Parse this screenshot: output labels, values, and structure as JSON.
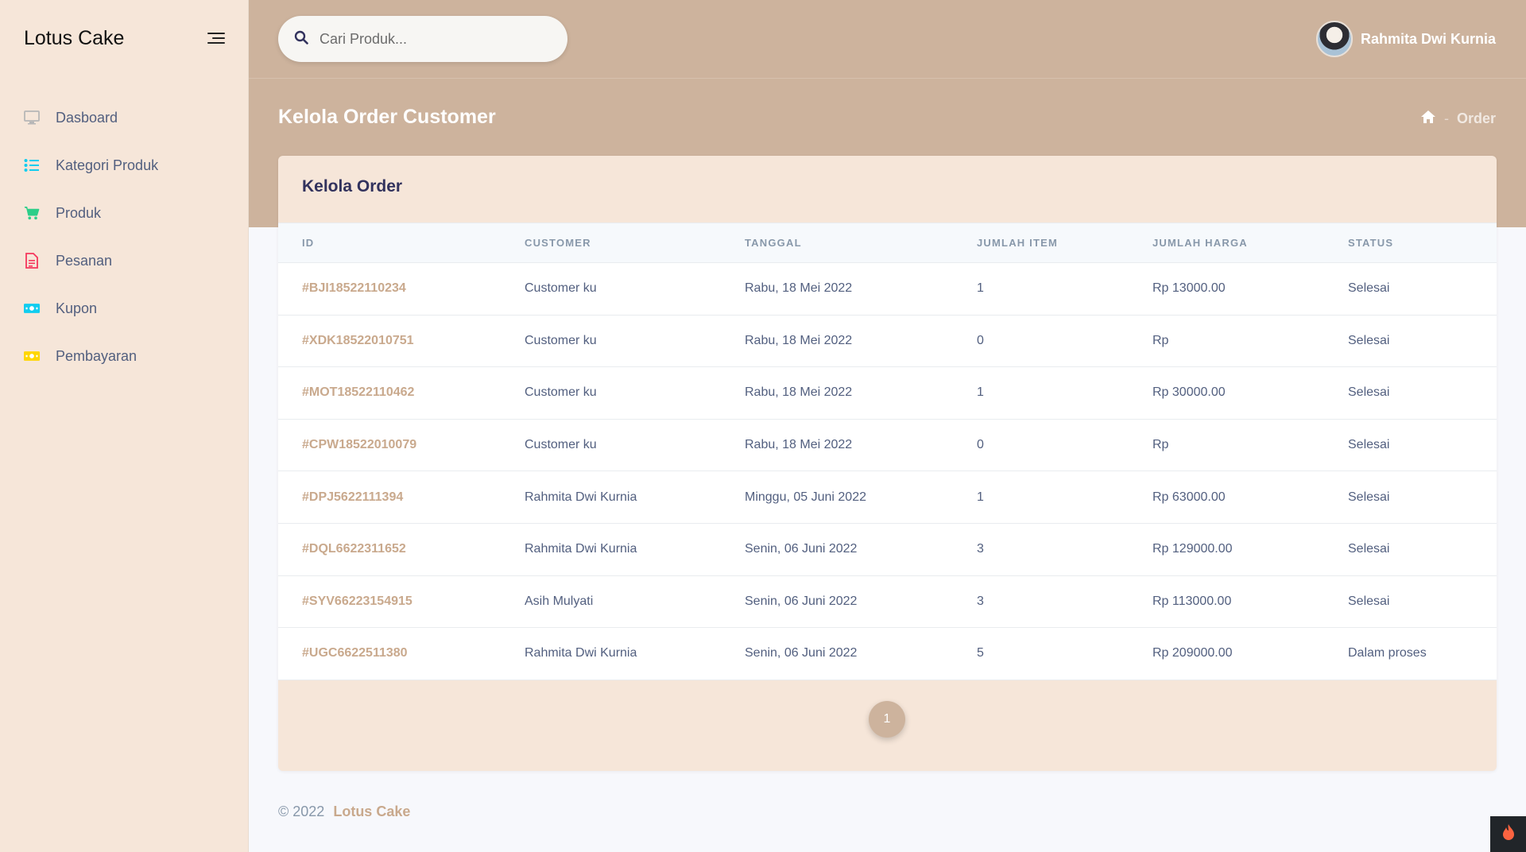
{
  "brand": "Lotus Cake",
  "sidebar": {
    "items": [
      {
        "label": "Dasboard",
        "icon": "monitor-icon",
        "color": "#b7b7b7"
      },
      {
        "label": "Kategori Produk",
        "icon": "list-icon",
        "color": "#11cdef"
      },
      {
        "label": "Produk",
        "icon": "cart-icon",
        "color": "#2dce89"
      },
      {
        "label": "Pesanan",
        "icon": "document-icon",
        "color": "#f5365c"
      },
      {
        "label": "Kupon",
        "icon": "money-icon",
        "color": "#11cdef"
      },
      {
        "label": "Pembayaran",
        "icon": "money-icon",
        "color": "#ffd600"
      }
    ]
  },
  "header": {
    "search_placeholder": "Cari Produk...",
    "user_name": "Rahmita Dwi Kurnia",
    "page_title": "Kelola Order Customer",
    "breadcrumb": [
      "Order"
    ]
  },
  "card": {
    "title": "Kelola Order",
    "columns": [
      "ID",
      "CUSTOMER",
      "TANGGAL",
      "JUMLAH ITEM",
      "JUMLAH HARGA",
      "STATUS"
    ],
    "rows": [
      [
        "#BJI18522110234",
        "Customer ku",
        "Rabu, 18 Mei 2022",
        "1",
        "Rp 13000.00",
        "Selesai"
      ],
      [
        "#XDK18522010751",
        "Customer ku",
        "Rabu, 18 Mei 2022",
        "0",
        "Rp",
        "Selesai"
      ],
      [
        "#MOT18522110462",
        "Customer ku",
        "Rabu, 18 Mei 2022",
        "1",
        "Rp 30000.00",
        "Selesai"
      ],
      [
        "#CPW18522010079",
        "Customer ku",
        "Rabu, 18 Mei 2022",
        "0",
        "Rp",
        "Selesai"
      ],
      [
        "#DPJ5622111394",
        "Rahmita Dwi Kurnia",
        "Minggu, 05 Juni 2022",
        "1",
        "Rp 63000.00",
        "Selesai"
      ],
      [
        "#DQL6622311652",
        "Rahmita Dwi Kurnia",
        "Senin, 06 Juni 2022",
        "3",
        "Rp 129000.00",
        "Selesai"
      ],
      [
        "#SYV66223154915",
        "Asih Mulyati",
        "Senin, 06 Juni 2022",
        "3",
        "Rp 113000.00",
        "Selesai"
      ],
      [
        "#UGC6622511380",
        "Rahmita Dwi Kurnia",
        "Senin, 06 Juni 2022",
        "5",
        "Rp 209000.00",
        "Dalam proses"
      ]
    ],
    "page": "1"
  },
  "footer": {
    "copyright": "© 2022",
    "brand": "Lotus Cake"
  },
  "colors": {
    "accent": "#cdb39d",
    "sidebar_bg": "#f6e6d9",
    "id_text": "#c9a98d"
  }
}
